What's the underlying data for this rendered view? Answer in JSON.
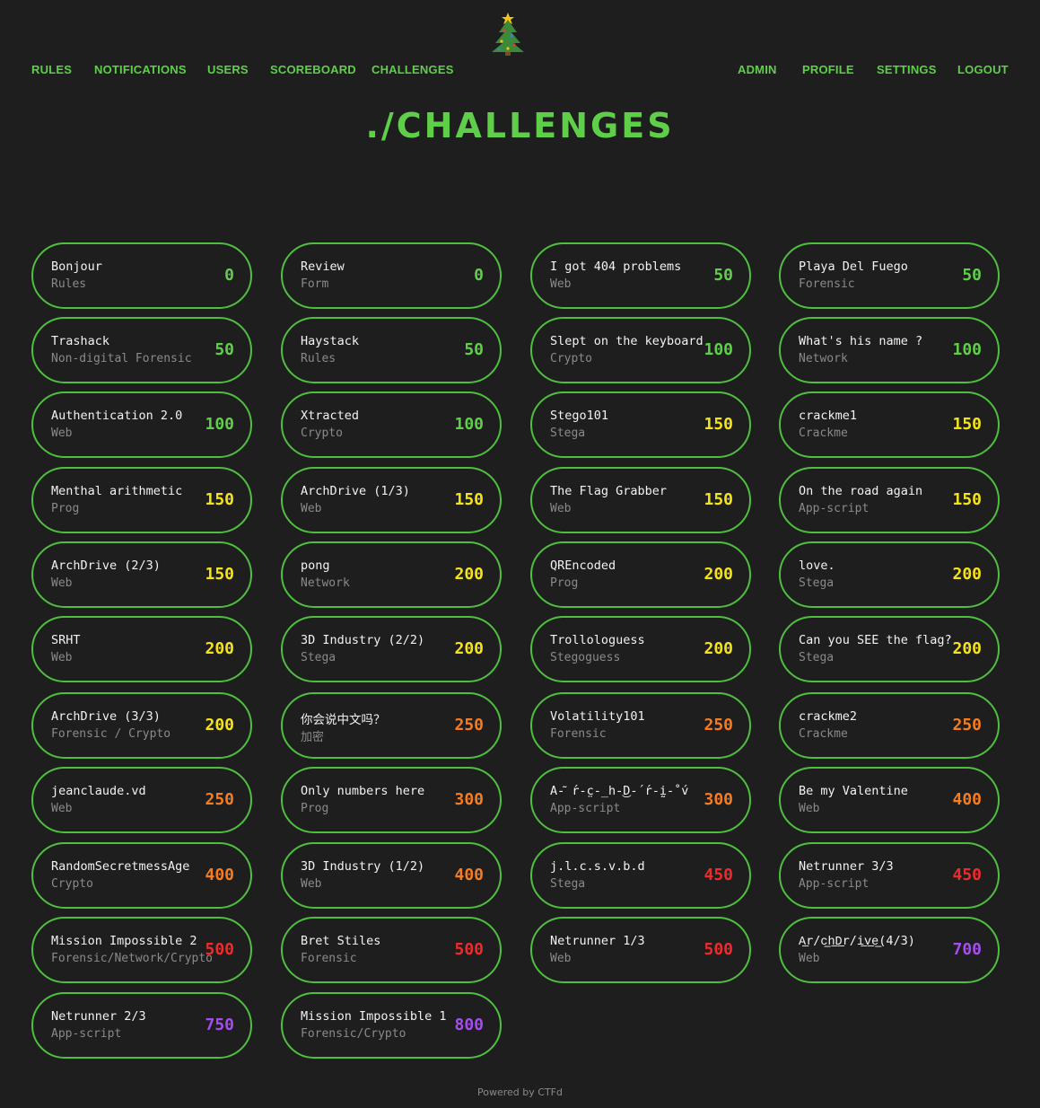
{
  "nav": {
    "left": [
      {
        "label": "RULES",
        "name": "nav-rules"
      },
      {
        "label": "NOTIFICATIONS",
        "name": "nav-notifications"
      },
      {
        "label": "USERS",
        "name": "nav-users"
      },
      {
        "label": "SCOREBOARD",
        "name": "nav-scoreboard"
      },
      {
        "label": "CHALLENGES",
        "name": "nav-challenges"
      }
    ],
    "right": [
      {
        "label": "ADMIN",
        "name": "nav-admin"
      },
      {
        "label": "PROFILE",
        "name": "nav-profile"
      },
      {
        "label": "SETTINGS",
        "name": "nav-settings"
      },
      {
        "label": "LOGOUT",
        "name": "nav-logout"
      }
    ]
  },
  "logo_icon": "christmas-tree-icon",
  "page_title": "./CHALLENGES",
  "colors": {
    "accent": "#5fcf4a",
    "points_low": "#5fcf4a",
    "points_mid": "#f5e31a",
    "points_high": "#f57c1f",
    "points_top": "#ef2a2a",
    "points_max": "#a54ef0"
  },
  "challenges": [
    {
      "name": "Bonjour",
      "category": "Rules",
      "points": "0",
      "tier": "low"
    },
    {
      "name": "Review",
      "category": "Form",
      "points": "0",
      "tier": "low"
    },
    {
      "name": "I got 404 problems",
      "category": "Web",
      "points": "50",
      "tier": "low"
    },
    {
      "name": "Playa Del Fuego",
      "category": "Forensic",
      "points": "50",
      "tier": "low"
    },
    {
      "name": "Trashack",
      "category": "Non-digital Forensic",
      "points": "50",
      "tier": "low"
    },
    {
      "name": "Haystack",
      "category": "Rules",
      "points": "50",
      "tier": "low"
    },
    {
      "name": "Slept on the keyboard",
      "category": "Crypto",
      "points": "100",
      "tier": "low"
    },
    {
      "name": "What's his name ?",
      "category": "Network",
      "points": "100",
      "tier": "low"
    },
    {
      "name": "Authentication 2.0",
      "category": "Web",
      "points": "100",
      "tier": "low"
    },
    {
      "name": "Xtracted",
      "category": "Crypto",
      "points": "100",
      "tier": "low"
    },
    {
      "name": "Stego101",
      "category": "Stega",
      "points": "150",
      "tier": "mid"
    },
    {
      "name": "crackme1",
      "category": "Crackme",
      "points": "150",
      "tier": "mid"
    },
    {
      "name": "Menthal arithmetic",
      "category": "Prog",
      "points": "150",
      "tier": "mid"
    },
    {
      "name": "ArchDrive (1/3)",
      "category": "Web",
      "points": "150",
      "tier": "mid"
    },
    {
      "name": "The Flag Grabber",
      "category": "Web",
      "points": "150",
      "tier": "mid"
    },
    {
      "name": "On the road again",
      "category": "App-script",
      "points": "150",
      "tier": "mid"
    },
    {
      "name": "ArchDrive (2/3)",
      "category": "Web",
      "points": "150",
      "tier": "mid"
    },
    {
      "name": "pong",
      "category": "Network",
      "points": "200",
      "tier": "mid"
    },
    {
      "name": "QREncoded",
      "category": "Prog",
      "points": "200",
      "tier": "mid"
    },
    {
      "name": "love.",
      "category": "Stega",
      "points": "200",
      "tier": "mid"
    },
    {
      "name": "SRHT",
      "category": "Web",
      "points": "200",
      "tier": "mid"
    },
    {
      "name": "3D Industry (2/2)",
      "category": "Stega",
      "points": "200",
      "tier": "mid"
    },
    {
      "name": "Trollologuess",
      "category": "Stegoguess",
      "points": "200",
      "tier": "mid"
    },
    {
      "name": "Can you SEE the flag?",
      "category": "Stega",
      "points": "200",
      "tier": "mid"
    },
    {
      "name": "ArchDrive (3/3)",
      "category": "Forensic / Crypto",
      "points": "200",
      "tier": "mid"
    },
    {
      "name": "你会说中文吗？",
      "category": "加密",
      "points": "250",
      "tier": "high"
    },
    {
      "name": "Volatility101",
      "category": "Forensic",
      "points": "250",
      "tier": "high"
    },
    {
      "name": "crackme2",
      "category": "Crackme",
      "points": "250",
      "tier": "high"
    },
    {
      "name": "jeanclaude.vd",
      "category": "Web",
      "points": "250",
      "tier": "high"
    },
    {
      "name": "Only numbers here",
      "category": "Prog",
      "points": "300",
      "tier": "high"
    },
    {
      "name": "A-͂ ́r-̤c-̲h-͜D-́ ́r-̰i-̊ ́v",
      "category": "App-script",
      "points": "300",
      "tier": "high"
    },
    {
      "name": "Be my Valentine",
      "category": "Web",
      "points": "400",
      "tier": "high"
    },
    {
      "name": "RandomSecretmessAge",
      "category": "Crypto",
      "points": "400",
      "tier": "high"
    },
    {
      "name": "3D Industry (1/2)",
      "category": "Web",
      "points": "400",
      "tier": "high"
    },
    {
      "name": "j.l.c.s.v.b.d",
      "category": "Stega",
      "points": "450",
      "tier": "top"
    },
    {
      "name": "Netrunner 3/3",
      "category": "App-script",
      "points": "450",
      "tier": "top"
    },
    {
      "name": "Mission Impossible 2",
      "category": "Forensic/Network/Crypto",
      "points": "500",
      "tier": "top"
    },
    {
      "name": "Bret Stiles",
      "category": "Forensic",
      "points": "500",
      "tier": "top"
    },
    {
      "name": "Netrunner 1/3",
      "category": "Web",
      "points": "500",
      "tier": "top"
    },
    {
      "name": "A͟r/c͟h͟D͟r/i͟v͟e͟(4/3)",
      "category": "Web",
      "points": "700",
      "tier": "max"
    },
    {
      "name": "Netrunner 2/3",
      "category": "App-script",
      "points": "750",
      "tier": "max"
    },
    {
      "name": "Mission Impossible 1",
      "category": "Forensic/Crypto",
      "points": "800",
      "tier": "max"
    }
  ],
  "footer": "Powered by CTFd"
}
